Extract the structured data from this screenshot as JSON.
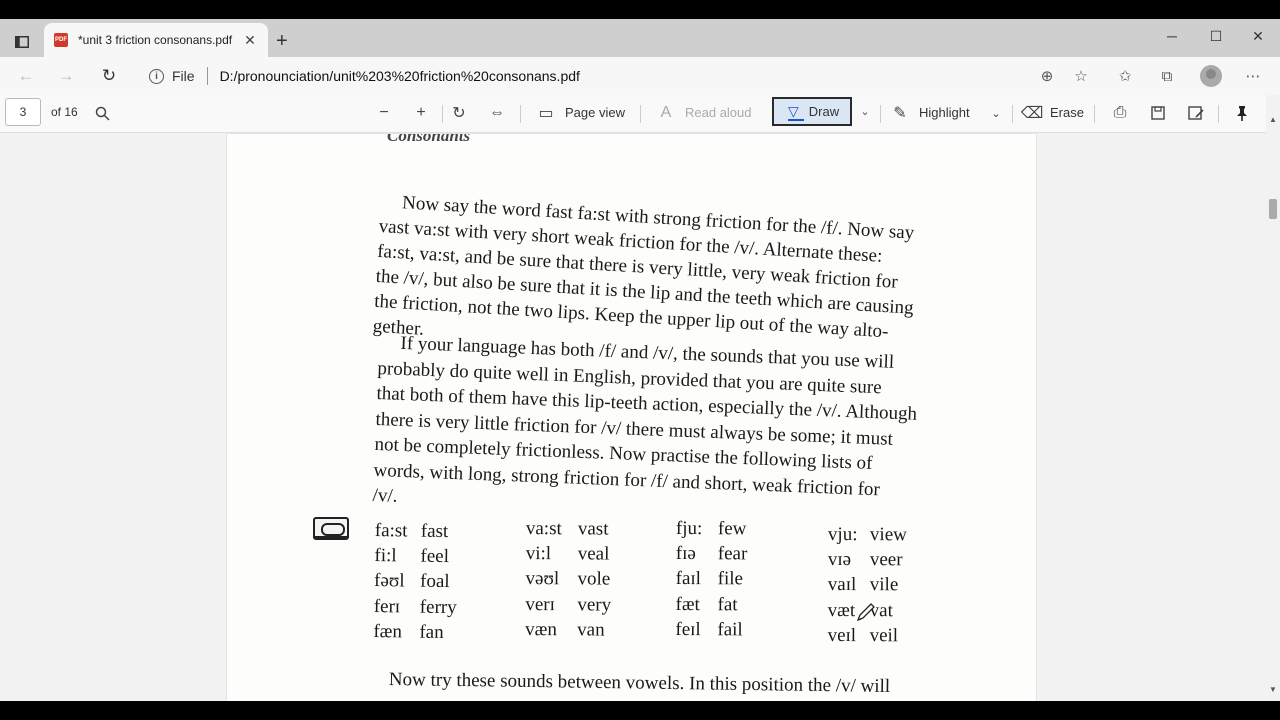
{
  "browser": {
    "tab": {
      "title": "*unit 3 friction consonans.pdf",
      "favicon": "PDF"
    },
    "address": {
      "security_label": "File",
      "url": "D:/pronounciation/unit%203%20friction%20consonans.pdf"
    },
    "icons": [
      "tab-actions-icon",
      "close-icon",
      "plus-icon",
      "minimize-icon",
      "maximize-icon",
      "close-window-icon",
      "back-icon",
      "forward-icon",
      "refresh-icon",
      "info-icon",
      "zoom-icon",
      "favorite-add-icon",
      "favorites-icon",
      "collections-icon",
      "profile-icon",
      "more-icon"
    ]
  },
  "pdf_toolbar": {
    "page_number": "3",
    "page_total": "of 16",
    "page_view_label": "Page view",
    "read_aloud_label": "Read aloud",
    "draw_label": "Draw",
    "highlight_label": "Highlight",
    "erase_label": "Erase"
  },
  "document": {
    "cutoff_heading": "Consonants",
    "para1": [
      "Now say the word fast fa:st with strong friction for the /f/. Now say",
      "vast va:st with very short weak friction for the /v/. Alternate these:",
      "fa:st, va:st, and be sure that there is very little, very weak friction for",
      "the /v/, but also be sure that it is the lip and the teeth which are causing",
      "the friction, not the two lips. Keep the upper lip out of the way alto-",
      "gether."
    ],
    "para2": [
      "If your language has both /f/ and /v/, the sounds that you use will",
      "probably do quite well in English, provided that you are quite sure",
      "that both of them have this lip-teeth action, especially the /v/. Although",
      "there is very little friction for /v/ there must always be some; it must",
      "not be completely frictionless. Now practise the following lists of",
      "words, with long, strong friction for /f/ and short, weak friction for",
      "/v/."
    ],
    "word_columns": [
      [
        {
          "ipa": "fa:st",
          "word": "fast"
        },
        {
          "ipa": "fi:l",
          "word": "feel"
        },
        {
          "ipa": "fəʊl",
          "word": "foal"
        },
        {
          "ipa": "ferɪ",
          "word": "ferry"
        },
        {
          "ipa": "fæn",
          "word": "fan"
        }
      ],
      [
        {
          "ipa": "va:st",
          "word": "vast"
        },
        {
          "ipa": "vi:l",
          "word": "veal"
        },
        {
          "ipa": "vəʊl",
          "word": "vole"
        },
        {
          "ipa": "verɪ",
          "word": "very"
        },
        {
          "ipa": "væn",
          "word": "van"
        }
      ],
      [
        {
          "ipa": "fju:",
          "word": "few"
        },
        {
          "ipa": "fɪə",
          "word": "fear"
        },
        {
          "ipa": "faɪl",
          "word": "file"
        },
        {
          "ipa": "fæt",
          "word": "fat"
        },
        {
          "ipa": "feɪl",
          "word": "fail"
        }
      ],
      [
        {
          "ipa": "vju:",
          "word": "view"
        },
        {
          "ipa": "vɪə",
          "word": "veer"
        },
        {
          "ipa": "vaɪl",
          "word": "vile"
        },
        {
          "ipa": "væt",
          "word": "vat"
        },
        {
          "ipa": "veɪl",
          "word": "veil"
        }
      ]
    ],
    "bottom_line": "Now try these sounds between vowels. In this position the /v/ will"
  },
  "colors": {
    "tabstrip": "#cfcfcf",
    "draw_active_bg": "#dbe6f5",
    "draw_pen": "#1a56c4",
    "pdf_badge": "#d03a2b"
  }
}
